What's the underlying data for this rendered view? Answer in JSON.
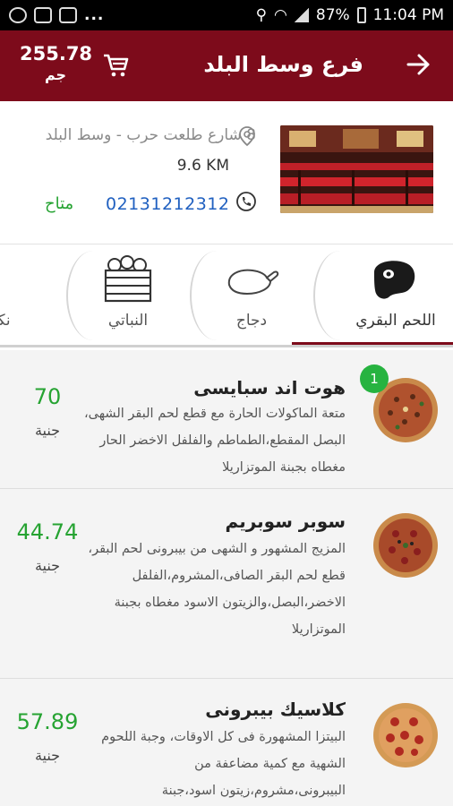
{
  "status_bar": {
    "battery": "87%",
    "time": "11:04 PM"
  },
  "header": {
    "total": "255.78",
    "currency": "جم",
    "title": "فرع وسط البلد"
  },
  "branch": {
    "address": "8 شارع طلعت حرب - وسط البلد",
    "distance": "9.6 KM",
    "phone": "02131212312",
    "availability": "متاح"
  },
  "categories": [
    {
      "label": "اللحم البقري",
      "icon": "steak-icon"
    },
    {
      "label": "دجاج",
      "icon": "chicken-icon"
    },
    {
      "label": "النباتي",
      "icon": "vegetable-crate-icon"
    },
    {
      "label": "نكه",
      "icon": ""
    }
  ],
  "menu_items": [
    {
      "name": "هوت اند سبايسى",
      "description": "متعة الماكولات الحارة مع قطع لحم البقر الشهى، البصل المقطع،الطماطم والفلفل الاخضر الحار مغطاه بجبنة الموتزاريلا",
      "price": "70",
      "currency": "جنية",
      "quantity": "1"
    },
    {
      "name": "سوبر سوبريم",
      "description": "المزيج المشهور و الشهى من بيبرونى لحم البقر، قطع لحم البقر الصافى،المشروم،الفلفل الاخضر،البصل،والزيتون الاسود مغطاه بجبنة الموتزاريلا",
      "price": "44.74",
      "currency": "جنية"
    },
    {
      "name": "كلاسيك بيبرونى",
      "description": "البيتزا المشهورة فى كل الاوقات، وجبة اللحوم الشهية مع كمية مضاعفة من البيبرونى،مشروم،زيتون اسود،جبنة",
      "price": "57.89",
      "currency": "جنية"
    }
  ],
  "colors": {
    "primary": "#7d0b1b",
    "price": "#26a332",
    "phone": "#2060c0",
    "badge": "#27b340"
  }
}
